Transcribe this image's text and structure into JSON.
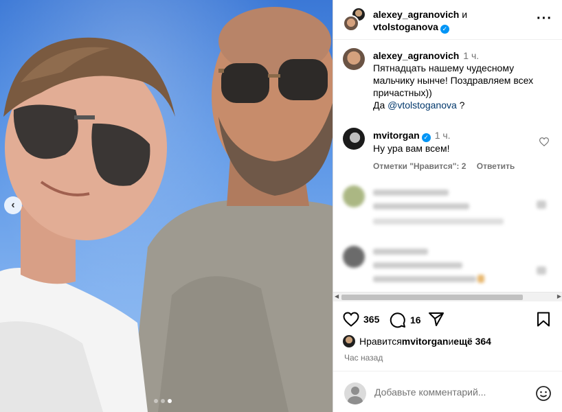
{
  "post": {
    "carousel": {
      "dots": 3,
      "active_index": 2,
      "prev_icon": "chevron-left-icon"
    }
  },
  "header": {
    "user1": "alexey_agranovich",
    "and": "и",
    "user2": "vtolstoganova",
    "more_icon": "more-horizontal-icon"
  },
  "comments": [
    {
      "user": "alexey_agranovich",
      "time": "1 ч.",
      "text": "Пятнадцать нашему чудесному мальчику нынче! Поздравляем всех причастных))",
      "text2_prefix": "Да ",
      "mention": "@vtolstoganova",
      "text2_suffix": " ?"
    },
    {
      "user": "mvitorgan",
      "time": "1 ч.",
      "text": "Ну ура вам всем!",
      "likes_label": "Отметки \"Нравится\": 2",
      "reply_label": "Ответить"
    }
  ],
  "actions": {
    "like_count": "365",
    "comment_count": "16",
    "like_icon": "heart-icon",
    "comment_icon": "comment-icon",
    "share_icon": "send-icon",
    "save_icon": "bookmark-icon"
  },
  "likes_line": {
    "prefix": "Нравится ",
    "user": "mvitorgan",
    "middle": " и ",
    "rest": "ещё 364"
  },
  "time_ago": "Час назад",
  "add_comment": {
    "placeholder": "Добавьте комментарий...",
    "emoji_icon": "smiley-icon"
  },
  "colors": {
    "verified": "#0095f6",
    "mention": "#00376b",
    "muted": "#737373"
  }
}
